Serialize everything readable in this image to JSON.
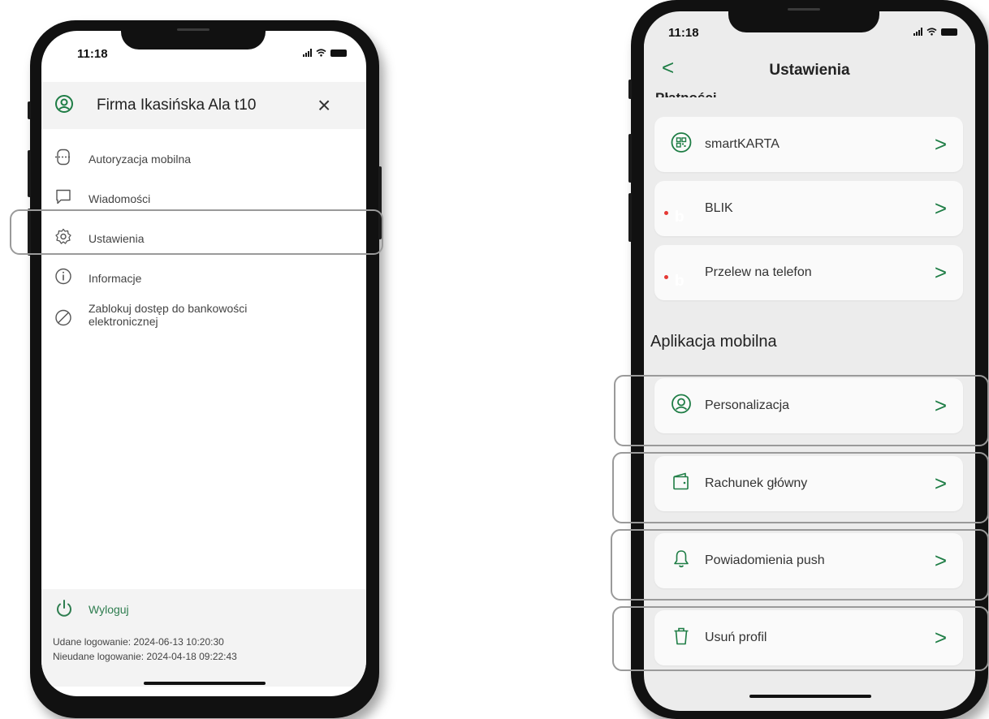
{
  "left_phone": {
    "status": {
      "time": "11:18"
    },
    "menu": {
      "user_name": "Firma Ikasińska Ala t10",
      "close_label": "×",
      "items": [
        {
          "label": "Autoryzacja mobilna",
          "icon": "mobile-auth-icon"
        },
        {
          "label": "Wiadomości",
          "icon": "message-icon"
        },
        {
          "label": "Ustawienia",
          "icon": "gear-icon"
        },
        {
          "label": "Informacje",
          "icon": "info-icon"
        },
        {
          "label_line1": "Zablokuj dostęp do bankowości",
          "label_line2": "elektronicznej",
          "icon": "block-icon"
        }
      ],
      "logout_label": "Wyloguj",
      "last_login_success": "Udane logowanie: 2024-06-13 10:20:30",
      "last_login_failed": "Nieudane logowanie: 2024-04-18 09:22:43"
    }
  },
  "right_phone": {
    "status": {
      "time": "11:18"
    },
    "nav": {
      "title": "Ustawienia",
      "back_label": "<"
    },
    "cut_section_title": "Płatności",
    "payments": [
      {
        "label": "smartKARTA",
        "icon": "qr-card-icon"
      },
      {
        "label": "BLIK",
        "icon": "blik-icon"
      },
      {
        "label": "Przelew na telefon",
        "icon": "blik-icon"
      }
    ],
    "app_section_title": "Aplikacja mobilna",
    "app_items": [
      {
        "label": "Personalizacja",
        "icon": "user-circle-icon"
      },
      {
        "label": "Rachunek główny",
        "icon": "wallet-icon"
      },
      {
        "label": "Powiadomienia push",
        "icon": "bell-icon"
      },
      {
        "label": "Usuń profil",
        "icon": "trash-icon"
      }
    ],
    "chevron": ">"
  },
  "colors": {
    "accent_green": "#1e7d45",
    "logout_green": "#2e7d4f",
    "highlight_gray": "#9a9a9a"
  }
}
